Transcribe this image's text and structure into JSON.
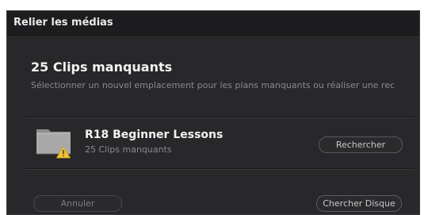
{
  "window": {
    "title": "Relier les médias"
  },
  "main": {
    "heading": "25 Clips manquants",
    "description": "Sélectionner un nouvel emplacement pour les plans manquants ou réaliser une rec"
  },
  "folder": {
    "icon": "folder-warning-icon",
    "name": "R18 Beginner Lessons",
    "subtitle": "25 Clips manquants",
    "search_label": "Rechercher"
  },
  "footer": {
    "cancel_label": "Annuler",
    "disk_search_label": "Chercher Disque"
  },
  "colors": {
    "background": "#28282a",
    "titlebar": "#1d1d1f",
    "warning": "#f2c230"
  }
}
